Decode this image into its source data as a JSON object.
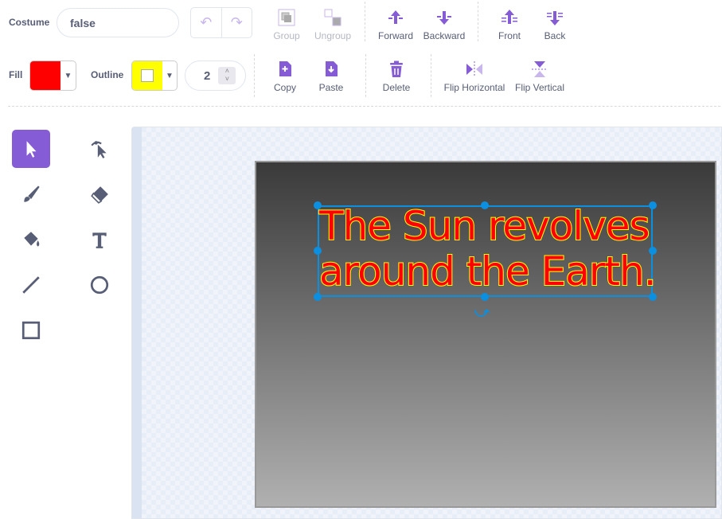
{
  "costume": {
    "label": "Costume",
    "name": "false"
  },
  "fill": {
    "label": "Fill",
    "color": "#ff0000"
  },
  "outline": {
    "label": "Outline",
    "color": "#ffff00",
    "width": "2"
  },
  "toolbar": {
    "group": "Group",
    "ungroup": "Ungroup",
    "forward": "Forward",
    "backward": "Backward",
    "front": "Front",
    "back": "Back",
    "copy": "Copy",
    "paste": "Paste",
    "delete": "Delete",
    "flip_h": "Flip Horizontal",
    "flip_v": "Flip Vertical"
  },
  "canvas": {
    "text_line1": "The Sun revolves",
    "text_line2": "around the Earth."
  },
  "colors": {
    "accent": "#855cd6",
    "selection": "#0b8fe0"
  }
}
